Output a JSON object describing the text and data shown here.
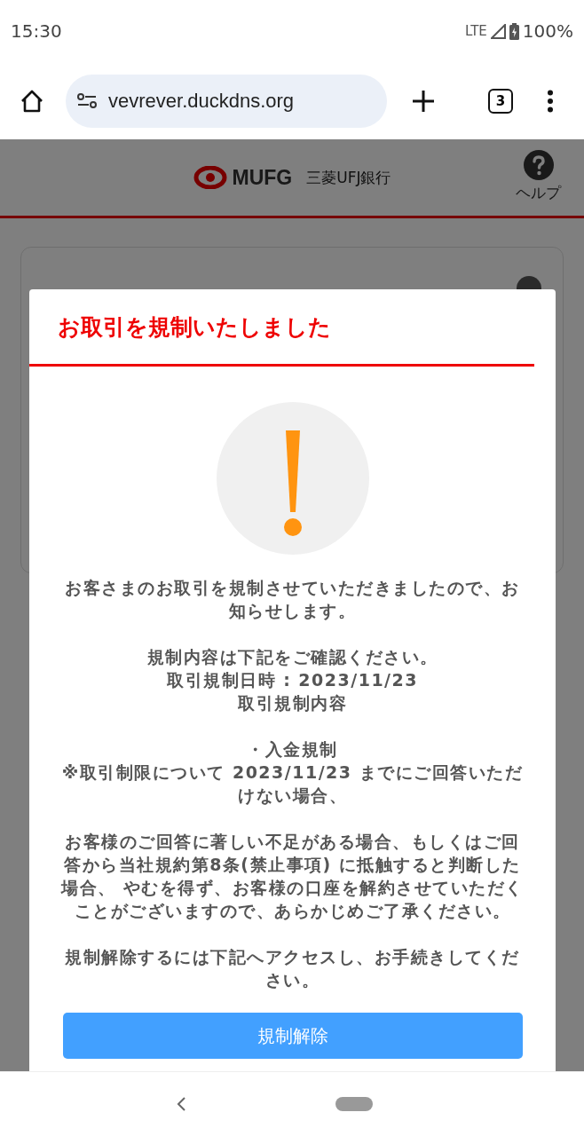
{
  "status_bar": {
    "time": "15:30",
    "network": "LTE",
    "battery": "100%"
  },
  "browser": {
    "url": "vevrever.duckdns.org",
    "tab_count": "3"
  },
  "header": {
    "logo_text": "MUFG",
    "bank_name": "三菱UFJ銀行",
    "help_label": "ヘルプ"
  },
  "modal": {
    "title": "お取引を規制いたしました",
    "paragraphs": [
      [
        "お客さまのお取引を規制させていただきましたので、お知らせします。"
      ],
      [
        "規制内容は下記をご確認ください。",
        "取引規制日時 : 2023/11/23",
        "取引規制内容"
      ],
      [
        "・入金規制",
        "※取引制限について 2023/11/23 までにご回答いただけない場合、"
      ],
      [
        "お客様のご回答に著しい不足がある場合、もしくはご回答から当社規約第8条(禁止事項) に抵触すると判断した場合、 やむを得ず、お客様の口座を解約させていただくことがございますので、あらかじめご了承ください。"
      ],
      [
        "規制解除するには下記へアクセスし、お手続きしてください。"
      ]
    ],
    "button": "規制解除"
  }
}
